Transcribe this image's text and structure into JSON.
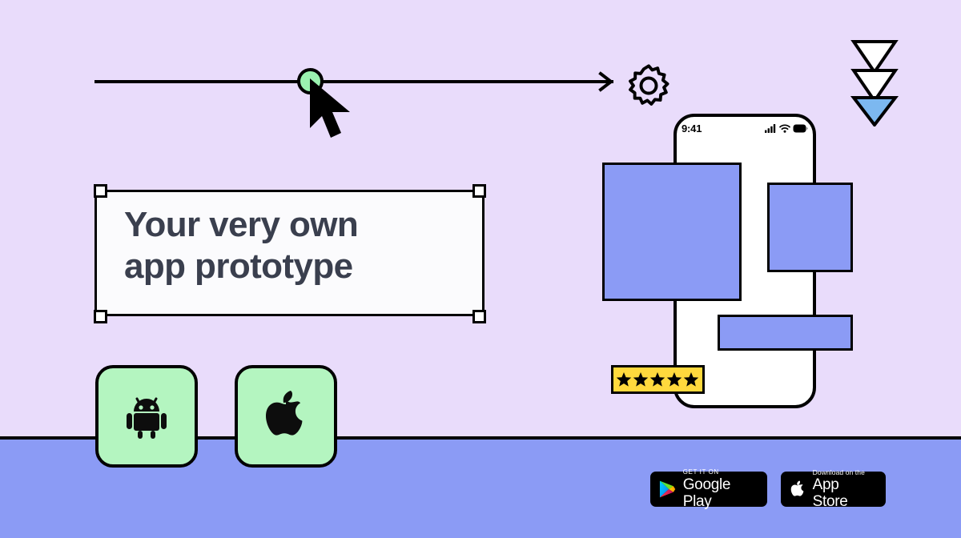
{
  "theme": {
    "background": "#e9dcfb",
    "band_color": "#8b9bf5",
    "accent_green": "#b4f5c0",
    "knob_green": "#9af2b0",
    "block_blue": "#8b9bf5",
    "badge_yellow": "#ffd93d",
    "text_dark": "#3a3f4e",
    "outline": "#000000",
    "triangle_fill": "#7cb8f0"
  },
  "headline": {
    "text": "Your very own\napp prototype"
  },
  "canvas_controls": {
    "slider_name": "progress-slider",
    "knob_label": "slider-handle",
    "cursor_label": "pointer-cursor",
    "gear_label": "settings-gear",
    "arrow_label": "arrow-line"
  },
  "triangles": [
    {
      "label": "triangle-outline-1",
      "filled": false
    },
    {
      "label": "triangle-outline-2",
      "filled": false
    },
    {
      "label": "triangle-filled-3",
      "filled": true
    }
  ],
  "platform_tiles": [
    {
      "name": "android-tile",
      "icon": "android-icon",
      "label": "Android"
    },
    {
      "name": "apple-tile",
      "icon": "apple-icon",
      "label": "Apple"
    }
  ],
  "phone": {
    "status_time": "9:41",
    "status_icons": [
      "cellular-signal-icon",
      "wifi-icon",
      "battery-icon"
    ],
    "blocks": [
      {
        "name": "hero-block"
      },
      {
        "name": "side-block"
      },
      {
        "name": "wide-block"
      }
    ],
    "rating": {
      "stars": 5,
      "star_glyph": "★"
    }
  },
  "store_badges": [
    {
      "name": "google-play-badge",
      "small_text": "GET IT ON",
      "big_text": "Google Play",
      "icon": "google-play-icon"
    },
    {
      "name": "app-store-badge",
      "small_text": "Download on the",
      "big_text": "App Store",
      "icon": "apple-icon"
    }
  ]
}
